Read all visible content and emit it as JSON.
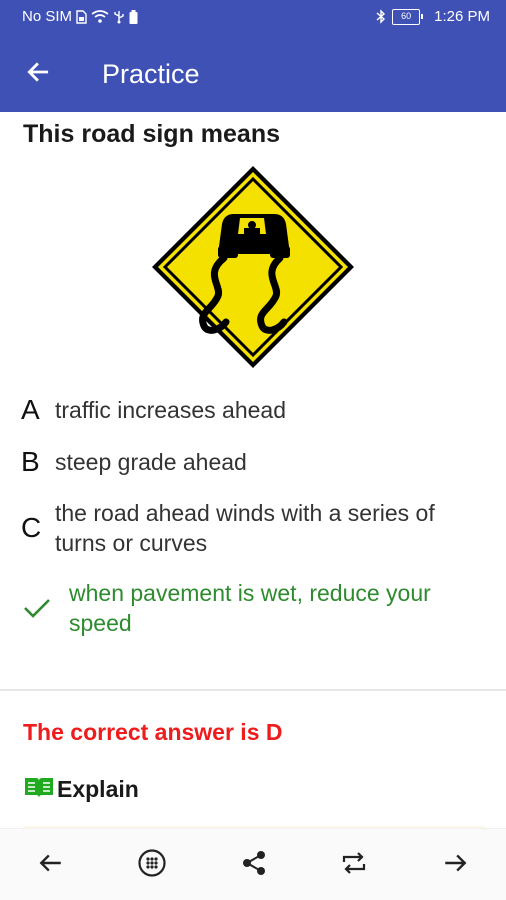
{
  "status_bar": {
    "carrier": "No SIM",
    "battery_level": "60",
    "time": "1:26 PM"
  },
  "app_bar": {
    "title": "Practice",
    "back_icon": "arrow-left-icon"
  },
  "question": {
    "prompt": "This road sign means",
    "image": "slippery-when-wet-sign",
    "options": [
      {
        "letter": "A",
        "text": "traffic increases ahead",
        "correct": false
      },
      {
        "letter": "B",
        "text": "steep grade ahead",
        "correct": false
      },
      {
        "letter": "C",
        "text": "the road ahead winds with a series of turns or curves",
        "correct": false
      },
      {
        "letter": "",
        "text": "when pavement is wet, reduce your speed",
        "correct": true
      }
    ]
  },
  "answer": {
    "correct_text": "The correct answer is D",
    "explain_label": "Explain"
  },
  "bottom_nav": {
    "icons": [
      "arrow-left-icon",
      "grid-icon",
      "share-icon",
      "repeat-icon",
      "arrow-right-icon"
    ]
  },
  "colors": {
    "primary": "#3f51b5",
    "correct_green": "#2e8b2e",
    "error_red": "#ee1c1c",
    "sign_yellow": "#f5e100"
  }
}
